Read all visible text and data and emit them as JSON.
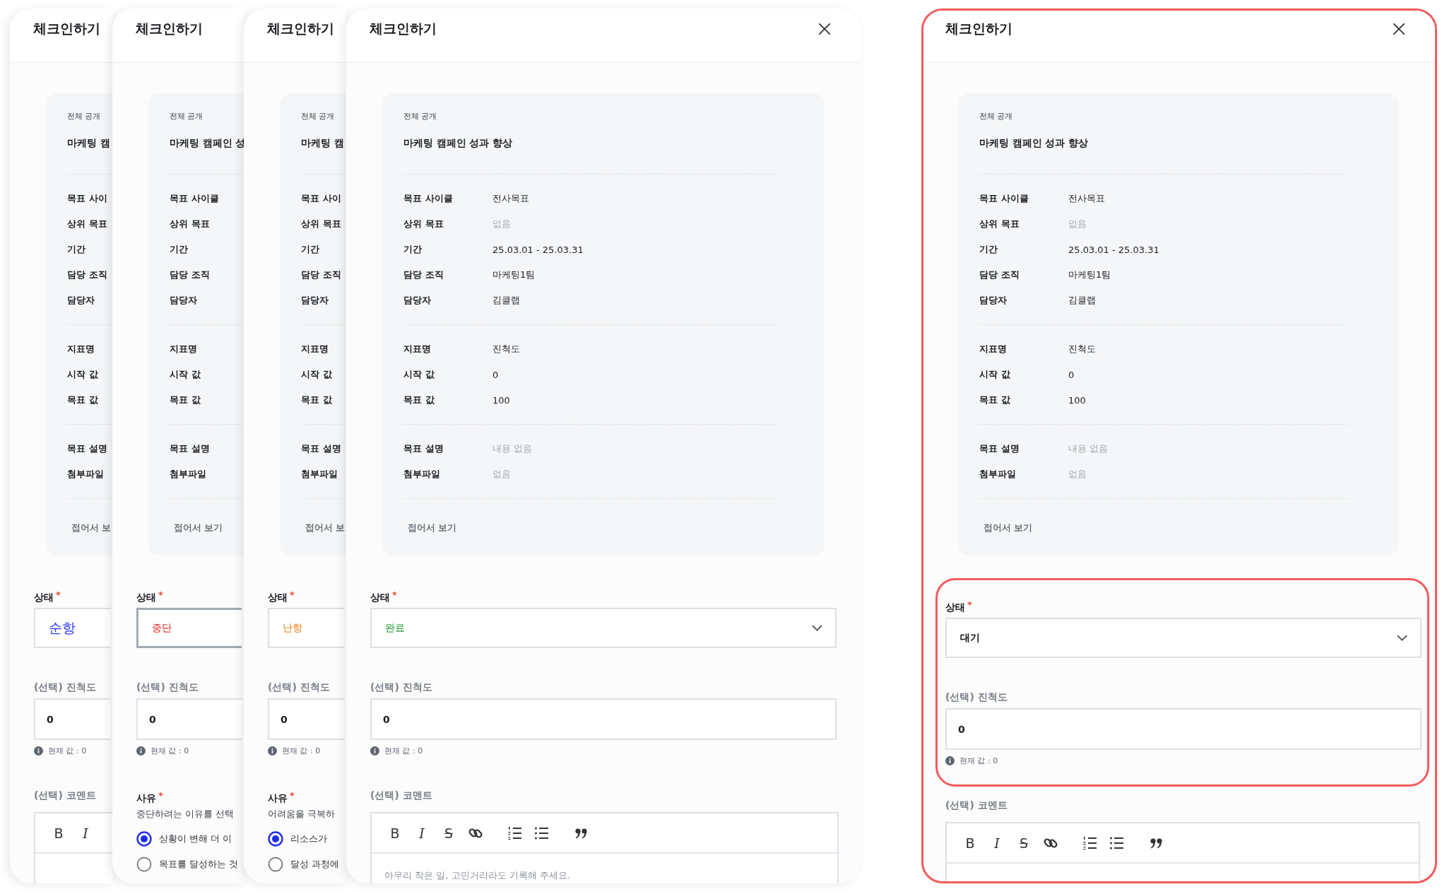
{
  "stack": [
    {
      "title": "체크인하기",
      "covered": true,
      "highlighted": false,
      "card": {
        "visibility": "전체 공개",
        "goal": "마케팅 캠",
        "groups": [
          [
            {
              "label": "목표 사이"
            },
            {
              "label": "상위 목표"
            },
            {
              "label": "기간"
            },
            {
              "label": "담당 조직"
            },
            {
              "label": "담당자"
            }
          ],
          [
            {
              "label": "지표명"
            },
            {
              "label": "시작 값"
            },
            {
              "label": "목표 값"
            }
          ],
          [
            {
              "label": "목표 설명"
            },
            {
              "label": "첨부파일"
            }
          ]
        ],
        "collapse": "접어서 보"
      },
      "status": {
        "label": "상태",
        "mark": "*",
        "value": "순항",
        "kind": "on_track",
        "focused": false
      },
      "progress": {
        "label": "(선택) **진척도**",
        "value": "0",
        "hint": "현재 값 : 0"
      },
      "comment": {
        "label": "(선택) **코멘트**",
        "tools": [
          {
            "kind": "bold",
            "glyph": "B"
          },
          {
            "kind": "italic",
            "glyph": "I"
          }
        ]
      }
    },
    {
      "title": "체크인하기",
      "covered": true,
      "highlighted": false,
      "card": {
        "visibility": "전체 공개",
        "goal": "마케팅 캠페인 성",
        "groups": [
          [
            {
              "label": "목표 사이클"
            },
            {
              "label": "상위 목표"
            },
            {
              "label": "기간"
            },
            {
              "label": "담당 조직"
            },
            {
              "label": "담당자"
            }
          ],
          [
            {
              "label": "지표명"
            },
            {
              "label": "시작 값"
            },
            {
              "label": "목표 값"
            }
          ],
          [
            {
              "label": "목표 설명"
            },
            {
              "label": "첨부파일"
            }
          ]
        ],
        "collapse": "접어서 보기"
      },
      "status": {
        "label": "상태",
        "mark": "*",
        "value": "중단",
        "kind": "stopped",
        "focused": true
      },
      "progress": {
        "label": "(선택) **진척도**",
        "value": "0",
        "hint": "현재 값 : 0"
      },
      "reason": {
        "label": "사유",
        "mark": "*",
        "hint": "중단하려는 이유를 선택",
        "options": [
          {
            "label": "상황이 변해 더 이",
            "selected": true
          },
          {
            "label": "목표를 달성하는 것",
            "selected": false
          }
        ]
      }
    },
    {
      "title": "체크인하기",
      "covered": true,
      "highlighted": false,
      "card": {
        "visibility": "전체 공개",
        "goal": "마케팅 캠",
        "groups": [
          [
            {
              "label": "목표 사이"
            },
            {
              "label": "상위 목표"
            },
            {
              "label": "기간"
            },
            {
              "label": "담당 조직"
            },
            {
              "label": "담당자"
            }
          ],
          [
            {
              "label": "지표명"
            },
            {
              "label": "시작 값"
            },
            {
              "label": "목표 값"
            }
          ],
          [
            {
              "label": "목표 설명"
            },
            {
              "label": "첨부파일"
            }
          ]
        ],
        "collapse": "접어서 보"
      },
      "status": {
        "label": "상태",
        "mark": "*",
        "value": "난항",
        "kind": "at_risk",
        "focused": false
      },
      "progress": {
        "label": "(선택) **진척도**",
        "value": "0",
        "hint": "현재 값 : 0"
      },
      "reason": {
        "label": "사유",
        "mark": "*",
        "hint": "어려움을 극복하",
        "options": [
          {
            "label": "리소스가",
            "selected": true
          },
          {
            "label": "달성 과정에",
            "selected": false
          }
        ]
      }
    },
    {
      "title": "체크인하기",
      "covered": false,
      "close": true,
      "highlighted": false,
      "card": {
        "visibility": "전체 공개",
        "goal": "마케팅 캠페인 성과 향상",
        "groups": [
          [
            {
              "label": "목표 사이클",
              "value": "전사목표",
              "muted": false
            },
            {
              "label": "상위 목표",
              "value": "없음",
              "muted": true
            },
            {
              "label": "기간",
              "value": "25.03.01 - 25.03.31",
              "muted": false
            },
            {
              "label": "담당 조직",
              "value": "마케팅1팀",
              "muted": false
            },
            {
              "label": "담당자",
              "value": "김클랩",
              "muted": false
            }
          ],
          [
            {
              "label": "지표명",
              "value": "진척도",
              "muted": false
            },
            {
              "label": "시작 값",
              "value": "0",
              "muted": false
            },
            {
              "label": "목표 값",
              "value": "100",
              "muted": false
            }
          ],
          [
            {
              "label": "목표 설명",
              "value": "내용 없음",
              "muted": true
            },
            {
              "label": "첨부파일",
              "value": "없음",
              "muted": true
            }
          ]
        ],
        "collapse": "접어서 보기"
      },
      "group_highlighted": false,
      "status": {
        "label": "상태",
        "mark": "*",
        "value": "완료",
        "kind": "done",
        "focused": false
      },
      "progress": {
        "label": "(선택) **진척도**",
        "value": "0",
        "hint": "현재 값 : 0"
      },
      "comment": {
        "label": "(선택) **코멘트**",
        "placeholder": "아무리 작은 일, 고민거리라도 기록해 주세요.",
        "tools": [
          {
            "kind": "bold",
            "glyph": "B"
          },
          {
            "kind": "italic",
            "glyph": "I"
          },
          {
            "kind": "strike",
            "glyph": "S"
          },
          {
            "kind": "link"
          },
          {
            "kind": "ordered"
          },
          {
            "kind": "bullet"
          },
          {
            "kind": "quote"
          }
        ]
      }
    }
  ],
  "focus_panel": {
    "title": "체크인하기",
    "covered": false,
    "close": true,
    "highlighted": true,
    "card": {
      "visibility": "전체 공개",
      "goal": "마케팅 캠페인 성과 향상",
      "groups": [
        [
          {
            "label": "목표 사이클",
            "value": "전사목표",
            "muted": false
          },
          {
            "label": "상위 목표",
            "value": "없음",
            "muted": true
          },
          {
            "label": "기간",
            "value": "25.03.01 - 25.03.31",
            "muted": false
          },
          {
            "label": "담당 조직",
            "value": "마케팅1팀",
            "muted": false
          },
          {
            "label": "담당자",
            "value": "김클랩",
            "muted": false
          }
        ],
        [
          {
            "label": "지표명",
            "value": "진척도",
            "muted": false
          },
          {
            "label": "시작 값",
            "value": "0",
            "muted": false
          },
          {
            "label": "목표 값",
            "value": "100",
            "muted": false
          }
        ],
        [
          {
            "label": "목표 설명",
            "value": "내용 없음",
            "muted": true
          },
          {
            "label": "첨부파일",
            "value": "없음",
            "muted": true
          }
        ]
      ],
      "collapse": "접어서 보기"
    },
    "group_highlighted": true,
    "status": {
      "label": "상태",
      "mark": "*",
      "value": "대기",
      "kind": "waiting",
      "focused": false
    },
    "progress": {
      "label": "(선택) **진척도**",
      "value": "0",
      "hint": "현재 값 : 0"
    },
    "comment": {
      "label": "(선택) **코멘트**",
      "tools": [
        {
          "kind": "bold",
          "glyph": "B"
        },
        {
          "kind": "italic",
          "glyph": "I"
        },
        {
          "kind": "strike",
          "glyph": "S"
        },
        {
          "kind": "link"
        },
        {
          "kind": "ordered"
        },
        {
          "kind": "bullet"
        },
        {
          "kind": "quote"
        }
      ]
    }
  }
}
